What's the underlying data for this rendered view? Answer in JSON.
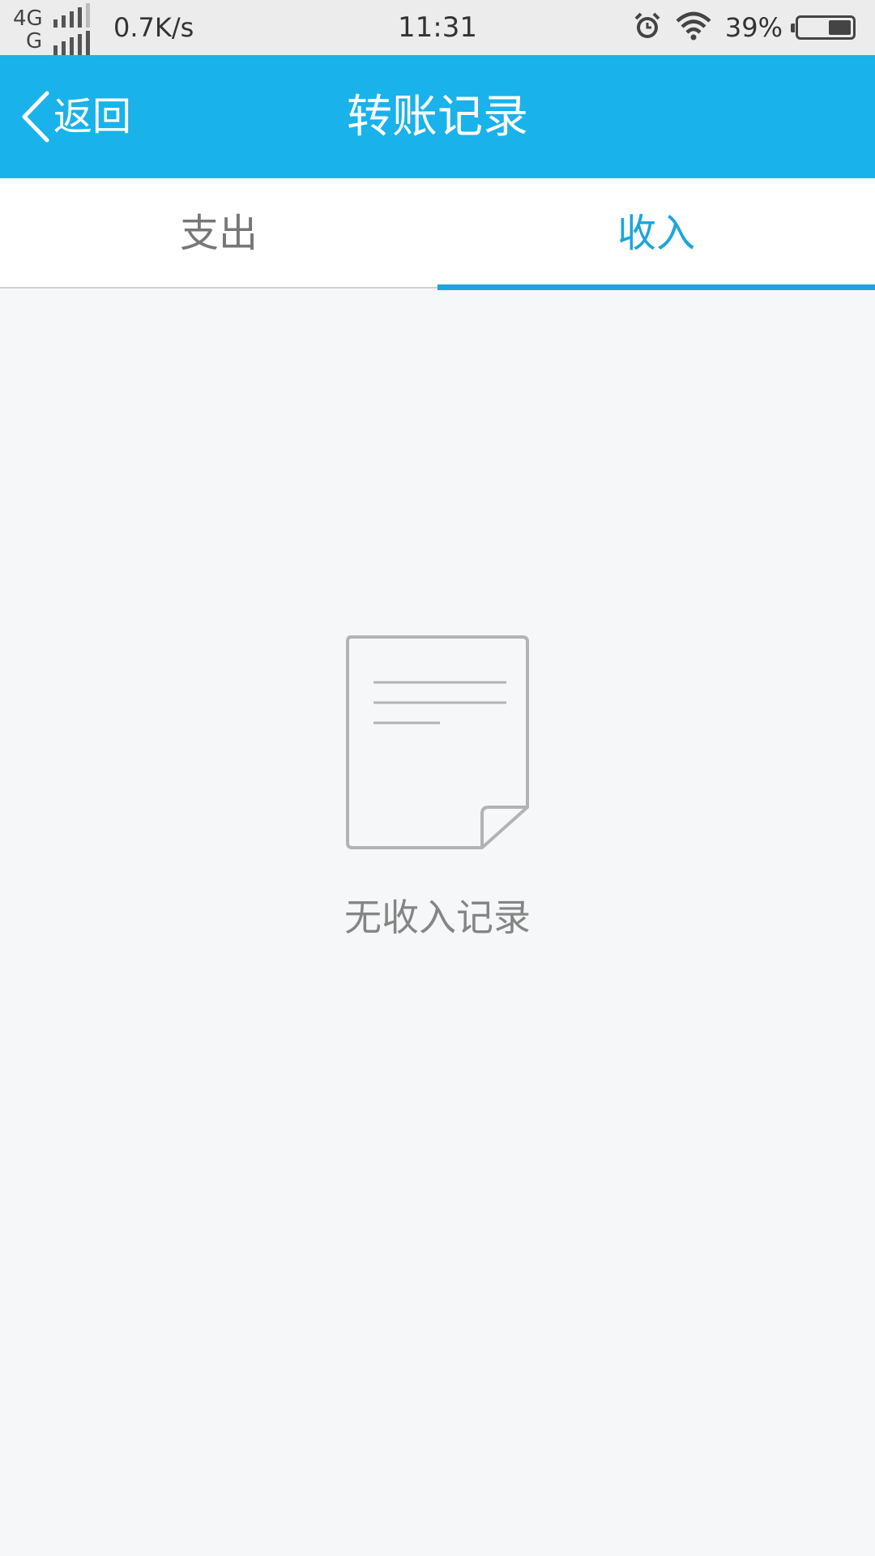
{
  "status_bar": {
    "network_top": "4G",
    "network_bottom": "G",
    "net_speed": "0.7K/s",
    "time": "11:31",
    "battery_percent": "39%",
    "battery_level": 0.39,
    "icons": [
      "signal-icon",
      "alarm-icon",
      "wifi-icon",
      "battery-icon"
    ]
  },
  "nav": {
    "back_label": "返回",
    "title": "转账记录",
    "background_color": "#1ab2ea"
  },
  "tabs": [
    {
      "label": "支出",
      "active": false
    },
    {
      "label": "收入",
      "active": true
    }
  ],
  "accent_color": "#1ba6dc",
  "empty_state": {
    "icon": "document-icon",
    "message": "无收入记录"
  }
}
